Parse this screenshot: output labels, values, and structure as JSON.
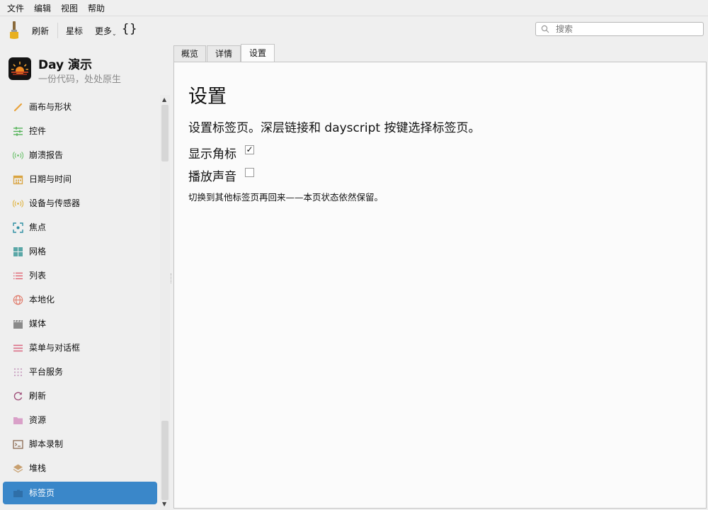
{
  "menubar": {
    "items": [
      "文件",
      "编辑",
      "视图",
      "帮助"
    ]
  },
  "toolbar": {
    "refresh_label": "刷新",
    "star_label": "星标",
    "more_label": "更多",
    "braces_label": "{}",
    "search_placeholder": "搜索"
  },
  "app": {
    "title": "Day 演示",
    "subtitle": "一份代码，处处原生"
  },
  "sidebar": {
    "items": [
      {
        "label": "画布与形状",
        "icon": "brush-icon",
        "color": "#e8a33d"
      },
      {
        "label": "控件",
        "icon": "sliders-icon",
        "color": "#4caf50"
      },
      {
        "label": "崩溃报告",
        "icon": "signal-icon",
        "color": "#6cc16c"
      },
      {
        "label": "日期与时间",
        "icon": "calendar-icon",
        "color": "#d9a441"
      },
      {
        "label": "设备与传感器",
        "icon": "signal-icon",
        "color": "#e0b340"
      },
      {
        "label": "焦点",
        "icon": "focus-icon",
        "color": "#2f8fa3"
      },
      {
        "label": "网格",
        "icon": "grid-icon",
        "color": "#5aa7a7"
      },
      {
        "label": "列表",
        "icon": "list-icon",
        "color": "#e05a6a"
      },
      {
        "label": "本地化",
        "icon": "globe-icon",
        "color": "#e07a6a"
      },
      {
        "label": "媒体",
        "icon": "clapper-icon",
        "color": "#8a8a8a"
      },
      {
        "label": "菜单与对话框",
        "icon": "menu-icon",
        "color": "#d9607a"
      },
      {
        "label": "平台服务",
        "icon": "dots-grid-icon",
        "color": "#c9a0c0"
      },
      {
        "label": "刷新",
        "icon": "refresh-icon",
        "color": "#a0507a"
      },
      {
        "label": "资源",
        "icon": "folder-icon",
        "color": "#d9a0c8"
      },
      {
        "label": "脚本录制",
        "icon": "terminal-icon",
        "color": "#8a6a50"
      },
      {
        "label": "堆栈",
        "icon": "layers-icon",
        "color": "#c8a070"
      },
      {
        "label": "标签页",
        "icon": "tabs-icon",
        "color": "#2f6fa8",
        "active": true
      }
    ]
  },
  "tabs": [
    {
      "label": "概览",
      "active": false
    },
    {
      "label": "详情",
      "active": false
    },
    {
      "label": "设置",
      "active": true
    }
  ],
  "content": {
    "title": "设置",
    "description": "设置标签页。深层链接和 dayscript 按键选择标签页。",
    "options": [
      {
        "label": "显示角标",
        "checked": true
      },
      {
        "label": "播放声音",
        "checked": false
      }
    ],
    "note": "切换到其他标签页再回来——本页状态依然保留。"
  }
}
